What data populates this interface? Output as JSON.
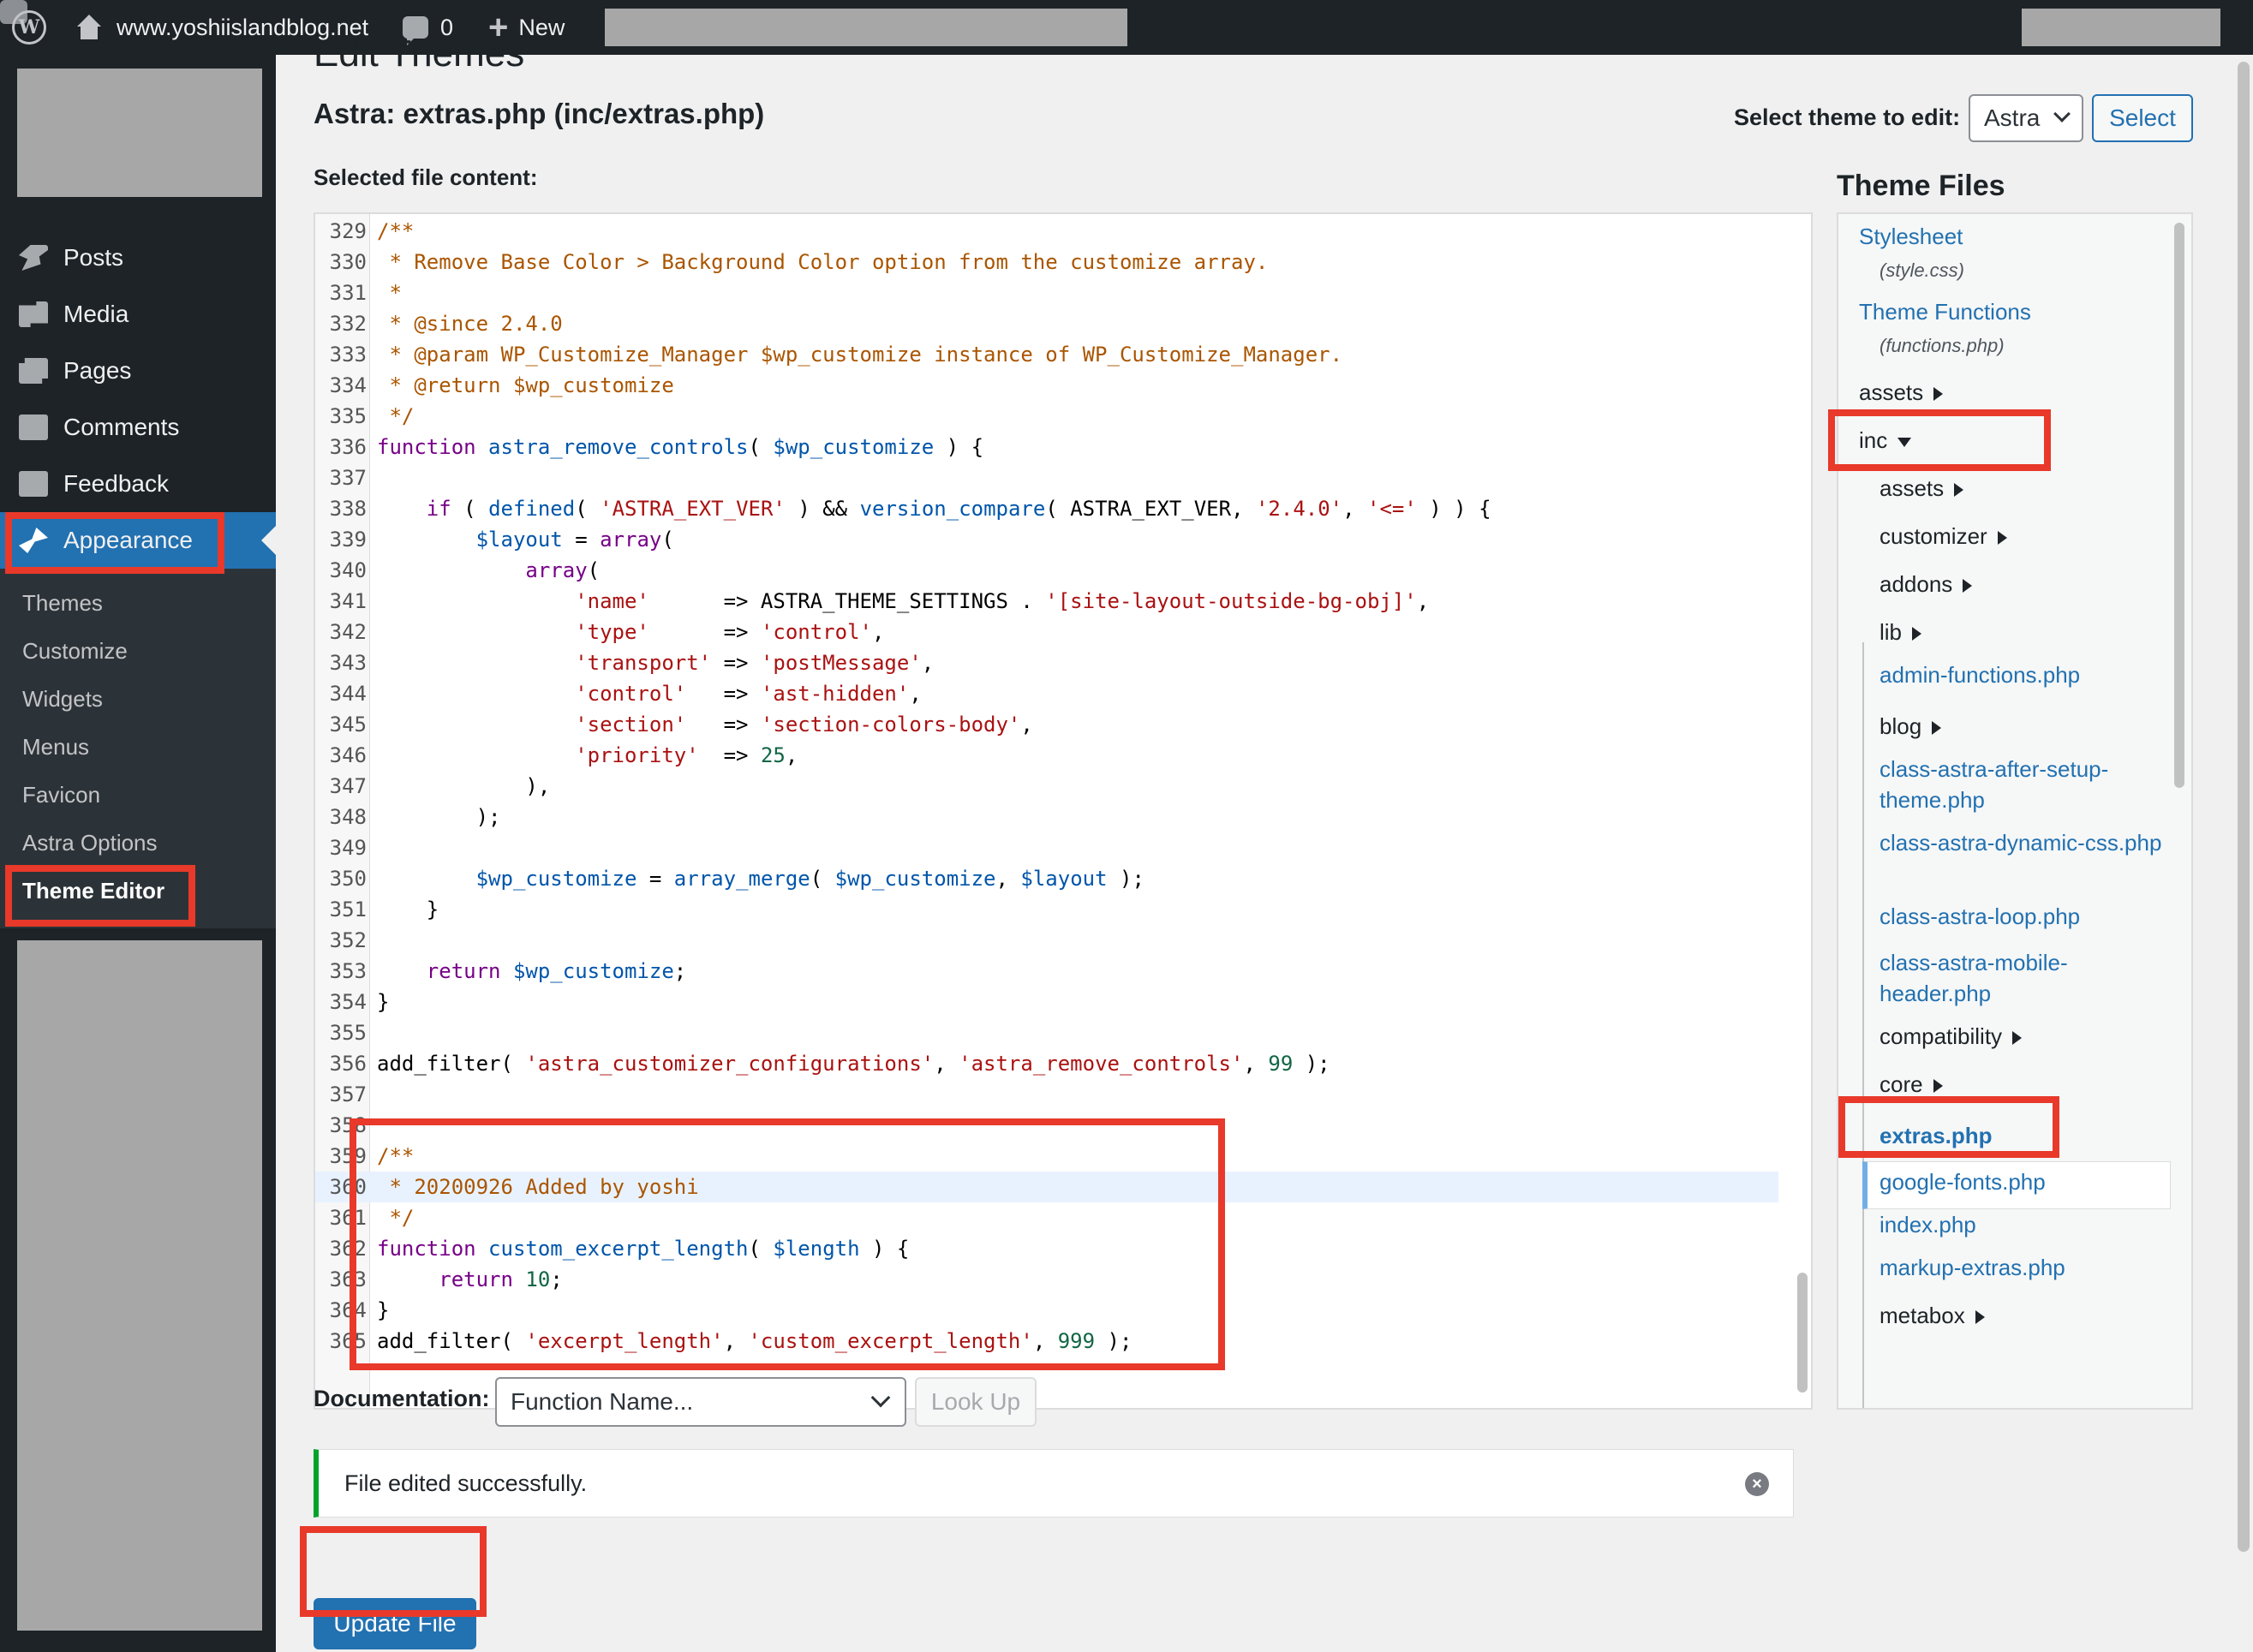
{
  "admin_bar": {
    "site_name": "www.yoshiislandblog.net",
    "comment_count": "0",
    "new_label": "New"
  },
  "sidebar": {
    "menu": [
      {
        "label": "Posts",
        "icon": "pin-icon"
      },
      {
        "label": "Media",
        "icon": "media-icon"
      },
      {
        "label": "Pages",
        "icon": "pages-icon"
      },
      {
        "label": "Comments",
        "icon": "comments-icon"
      },
      {
        "label": "Feedback",
        "icon": "feedback-icon"
      }
    ],
    "appearance_label": "Appearance",
    "submenu": [
      "Themes",
      "Customize",
      "Widgets",
      "Menus",
      "Favicon",
      "Astra Options",
      "Theme Editor"
    ],
    "current_submenu": "Theme Editor"
  },
  "main": {
    "page_heading": "Edit Themes",
    "file_title": "Astra: extras.php (inc/extras.php)",
    "select_theme_label": "Select theme to edit:",
    "selected_theme": "Astra",
    "select_button": "Select",
    "selected_file_label": "Selected file content:"
  },
  "code": {
    "active_line": "360",
    "lines": [
      {
        "n": "329",
        "html": "<span class=\"cm\">/**</span>"
      },
      {
        "n": "330",
        "html": "<span class=\"cm\"> * Remove Base Color &gt; Background Color option from the customize array.</span>"
      },
      {
        "n": "331",
        "html": "<span class=\"cm\"> *</span>"
      },
      {
        "n": "332",
        "html": "<span class=\"cm\"> * @since 2.4.0</span>"
      },
      {
        "n": "333",
        "html": "<span class=\"cm\"> * @param WP_Customize_Manager $wp_customize instance of WP_Customize_Manager.</span>"
      },
      {
        "n": "334",
        "html": "<span class=\"cm\"> * @return $wp_customize</span>"
      },
      {
        "n": "335",
        "html": "<span class=\"cm\"> */</span>"
      },
      {
        "n": "336",
        "html": "<span class=\"kw\">function</span> <span class=\"fn\">astra_remove_controls</span>( <span class=\"vr\">$wp_customize</span> ) {"
      },
      {
        "n": "337",
        "html": ""
      },
      {
        "n": "338",
        "html": "    <span class=\"kw\">if</span> ( <span class=\"fn\">defined</span>( <span class=\"st\">'ASTRA_EXT_VER'</span> ) &amp;&amp; <span class=\"fn\">version_compare</span>( ASTRA_EXT_VER, <span class=\"st\">'2.4.0'</span>, <span class=\"st\">'&lt;='</span> ) ) {"
      },
      {
        "n": "339",
        "html": "        <span class=\"vr\">$layout</span> = <span class=\"kw\">array</span>("
      },
      {
        "n": "340",
        "html": "            <span class=\"kw\">array</span>("
      },
      {
        "n": "341",
        "html": "                <span class=\"st\">'name'</span>      =&gt; ASTRA_THEME_SETTINGS . <span class=\"st\">'[site-layout-outside-bg-obj]'</span>,"
      },
      {
        "n": "342",
        "html": "                <span class=\"st\">'type'</span>      =&gt; <span class=\"st\">'control'</span>,"
      },
      {
        "n": "343",
        "html": "                <span class=\"st\">'transport'</span> =&gt; <span class=\"st\">'postMessage'</span>,"
      },
      {
        "n": "344",
        "html": "                <span class=\"st\">'control'</span>   =&gt; <span class=\"st\">'ast-hidden'</span>,"
      },
      {
        "n": "345",
        "html": "                <span class=\"st\">'section'</span>   =&gt; <span class=\"st\">'section-colors-body'</span>,"
      },
      {
        "n": "346",
        "html": "                <span class=\"st\">'priority'</span>  =&gt; <span class=\"nu\">25</span>,"
      },
      {
        "n": "347",
        "html": "            ),"
      },
      {
        "n": "348",
        "html": "        );"
      },
      {
        "n": "349",
        "html": ""
      },
      {
        "n": "350",
        "html": "        <span class=\"vr\">$wp_customize</span> = <span class=\"fn\">array_merge</span>( <span class=\"vr\">$wp_customize</span>, <span class=\"vr\">$layout</span> );"
      },
      {
        "n": "351",
        "html": "    }"
      },
      {
        "n": "352",
        "html": ""
      },
      {
        "n": "353",
        "html": "    <span class=\"kw\">return</span> <span class=\"vr\">$wp_customize</span>;"
      },
      {
        "n": "354",
        "html": "}"
      },
      {
        "n": "355",
        "html": ""
      },
      {
        "n": "356",
        "html": "add_filter( <span class=\"st\">'astra_customizer_configurations'</span>, <span class=\"st\">'astra_remove_controls'</span>, <span class=\"nu\">99</span> );"
      },
      {
        "n": "357",
        "html": ""
      },
      {
        "n": "358",
        "html": ""
      },
      {
        "n": "359",
        "html": "<span class=\"cm\">/**</span>"
      },
      {
        "n": "360",
        "html": "<span class=\"cm\"> * 20200926 Added by yoshi</span>"
      },
      {
        "n": "361",
        "html": "<span class=\"cm\"> */</span>"
      },
      {
        "n": "362",
        "html": "<span class=\"kw\">function</span> <span class=\"fn\">custom_excerpt_length</span>( <span class=\"vr\">$length</span> ) {"
      },
      {
        "n": "363",
        "html": "     <span class=\"kw\">return</span> <span class=\"nu\">10</span>;"
      },
      {
        "n": "364",
        "html": "}"
      },
      {
        "n": "365",
        "html": "add_filter( <span class=\"st\">'excerpt_length'</span>, <span class=\"st\">'custom_excerpt_length'</span>, <span class=\"nu\">999</span> );"
      }
    ]
  },
  "theme_files": {
    "title": "Theme Files",
    "stylesheet": "Stylesheet",
    "stylesheet_file": "(style.css)",
    "functions": "Theme Functions",
    "functions_file": "(functions.php)",
    "assets": "assets",
    "inc": "inc",
    "inc_children": [
      {
        "label": "assets",
        "type": "dir"
      },
      {
        "label": "customizer",
        "type": "dir"
      },
      {
        "label": "addons",
        "type": "dir"
      },
      {
        "label": "lib",
        "type": "dir"
      },
      {
        "label": "admin-functions.php",
        "type": "file"
      },
      {
        "label": "blog",
        "type": "dir"
      },
      {
        "label": "class-astra-after-setup-theme.php",
        "type": "file"
      },
      {
        "label": "class-astra-dynamic-css.php",
        "type": "file"
      },
      {
        "label": "class-astra-loop.php",
        "type": "file"
      },
      {
        "label": "class-astra-mobile-header.php",
        "type": "file"
      },
      {
        "label": "compatibility",
        "type": "dir"
      },
      {
        "label": "core",
        "type": "dir"
      },
      {
        "label": "extras.php",
        "type": "current"
      },
      {
        "label": "google-fonts.php",
        "type": "file"
      },
      {
        "label": "index.php",
        "type": "file"
      },
      {
        "label": "markup-extras.php",
        "type": "file"
      },
      {
        "label": "metabox",
        "type": "dir"
      }
    ]
  },
  "documentation": {
    "label": "Documentation:",
    "placeholder": "Function Name...",
    "lookup_button": "Look Up"
  },
  "notice": {
    "message": "File edited successfully."
  },
  "update_button": "Update File",
  "colors": {
    "admin_dark": "#1d2327",
    "wp_blue": "#2271b1",
    "highlight_red": "#e8392a",
    "success_green": "#00a32a"
  }
}
